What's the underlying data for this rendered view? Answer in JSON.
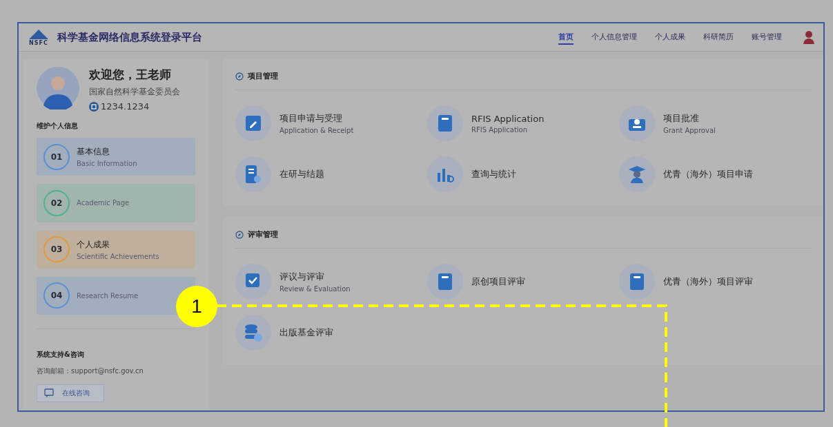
{
  "header": {
    "logo_text": "NSFC",
    "title": "科学基金网络信息系统登录平台",
    "nav": [
      {
        "label": "首页",
        "selected": true
      },
      {
        "label": "个人信息管理",
        "selected": false
      },
      {
        "label": "个人成果",
        "selected": false
      },
      {
        "label": "科研简历",
        "selected": false
      },
      {
        "label": "账号管理",
        "selected": false
      }
    ]
  },
  "profile": {
    "greeting": "欢迎您，王老师",
    "organization": "国家自然科学基金委员会",
    "account": "1234.1234"
  },
  "maintain": {
    "title": "维护个人信息",
    "cards": [
      {
        "number": "01",
        "title": "基本信息",
        "subtitle": "Basic Information",
        "color": "#5b8fd6"
      },
      {
        "number": "02",
        "subtitle": "Academic Page",
        "color": "#4fb38a"
      },
      {
        "number": "03",
        "title": "个人成果",
        "subtitle": "Scientific Achievements",
        "color": "#e39a3c"
      },
      {
        "number": "04",
        "subtitle": "Research Resume",
        "color": "#5b8fd6"
      }
    ]
  },
  "support": {
    "title": "系统支持&咨询",
    "email": "咨询邮箱：support@nsfc.gov.cn",
    "button": "在线咨询"
  },
  "sections": [
    {
      "title": "项目管理",
      "items": [
        {
          "title": "项目申请与受理",
          "subtitle": "Application & Receipt",
          "kind": "edit"
        },
        {
          "title": "RFIS Application",
          "subtitle": "RFIS Application",
          "kind": "doc"
        },
        {
          "title": "项目批准",
          "subtitle": "Grant Approval",
          "kind": "stamp"
        },
        {
          "title": "在研与结题",
          "kind": "list"
        },
        {
          "title": "查询与统计",
          "kind": "chart"
        },
        {
          "title": "优青（海外）项目申请",
          "kind": "graduate"
        }
      ]
    },
    {
      "title": "评审管理",
      "items": [
        {
          "title": "评议与评审",
          "subtitle": "Review & Evaluation",
          "kind": "check"
        },
        {
          "title": "原创项目评审",
          "kind": "doc"
        },
        {
          "title": "优青（海外）项目评审",
          "kind": "doc"
        },
        {
          "title": "出版基金评审",
          "kind": "database"
        }
      ]
    }
  ],
  "annotation": {
    "label": "1"
  }
}
